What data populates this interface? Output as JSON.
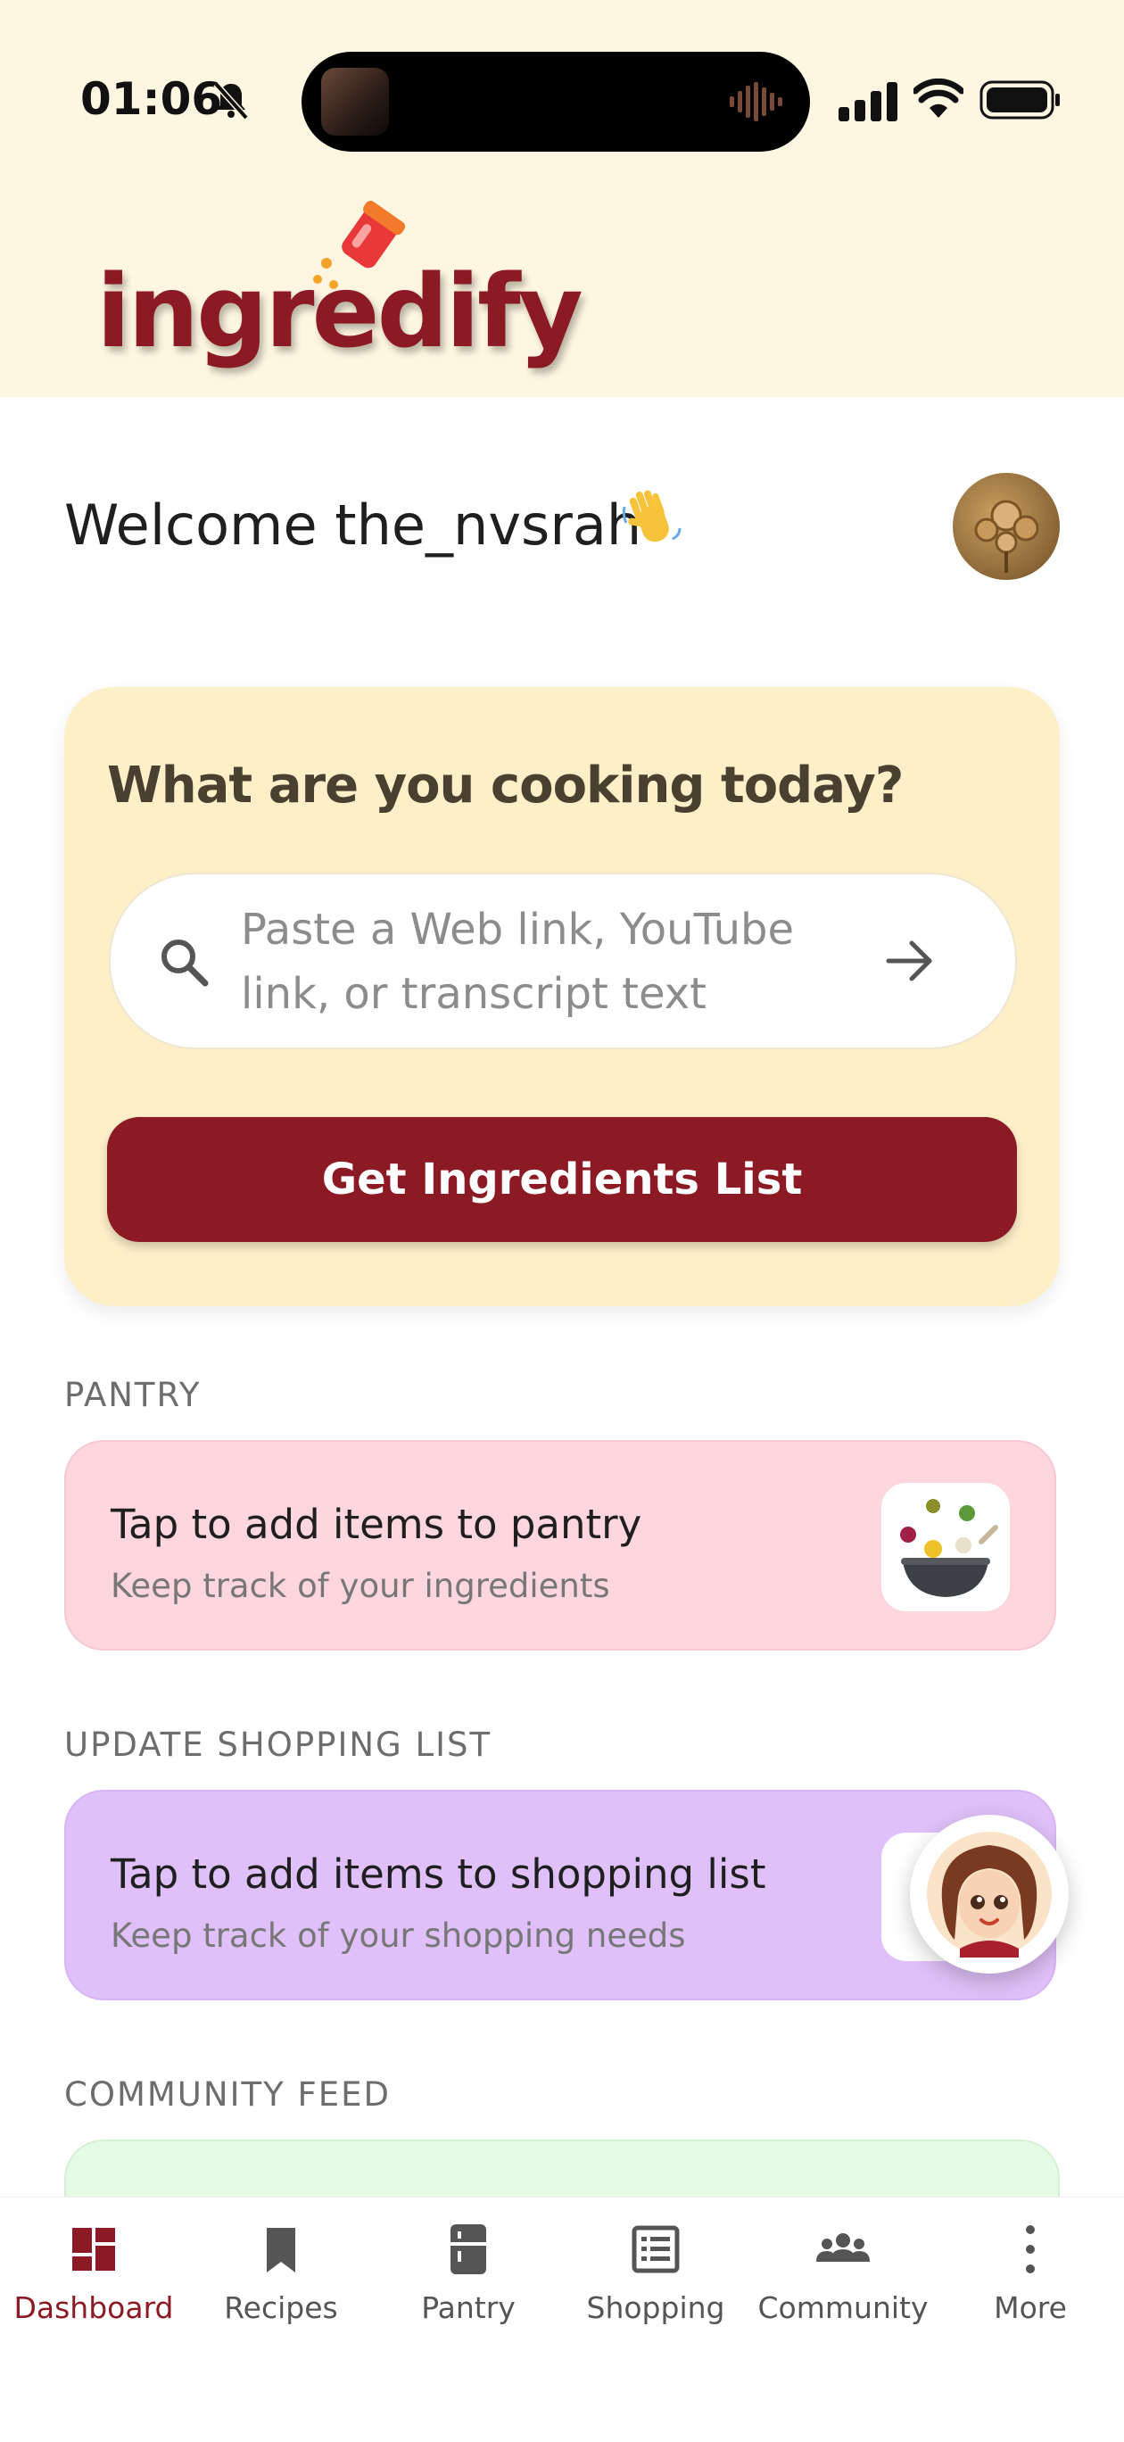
{
  "status_bar": {
    "time": "01:06"
  },
  "app": {
    "logo_text": "ingredify"
  },
  "welcome": {
    "text": "Welcome  the_nvsrah"
  },
  "cook_card": {
    "title": "What are you cooking today?",
    "search_placeholder": "Paste a Web link, YouTube link, or transcript text",
    "button_label": "Get Ingredients List"
  },
  "pantry": {
    "section_label": "PANTRY",
    "title": "Tap to add items to pantry",
    "subtitle": "Keep track of your ingredients"
  },
  "shopping": {
    "section_label": "UPDATE SHOPPING LIST",
    "title": "Tap to add items to shopping list",
    "subtitle": "Keep track of your shopping needs"
  },
  "community": {
    "section_label": "COMMUNITY FEED"
  },
  "bottom_nav": [
    {
      "label": "Dashboard",
      "icon": "dashboard-icon",
      "active": true
    },
    {
      "label": "Recipes",
      "icon": "bookmark-icon",
      "active": false
    },
    {
      "label": "Pantry",
      "icon": "fridge-icon",
      "active": false
    },
    {
      "label": "Shopping",
      "icon": "list-icon",
      "active": false
    },
    {
      "label": "Community",
      "icon": "people-icon",
      "active": false
    },
    {
      "label": "More",
      "icon": "more-vertical-icon",
      "active": false
    }
  ],
  "colors": {
    "brand": "#8c1a24",
    "header_bg": "#fef6e0",
    "cook_card_bg": "#fdefc8",
    "pantry_bg": "#fdd6de",
    "shopping_bg": "#e0c0f8",
    "community_bg": "#e6fbe6"
  }
}
